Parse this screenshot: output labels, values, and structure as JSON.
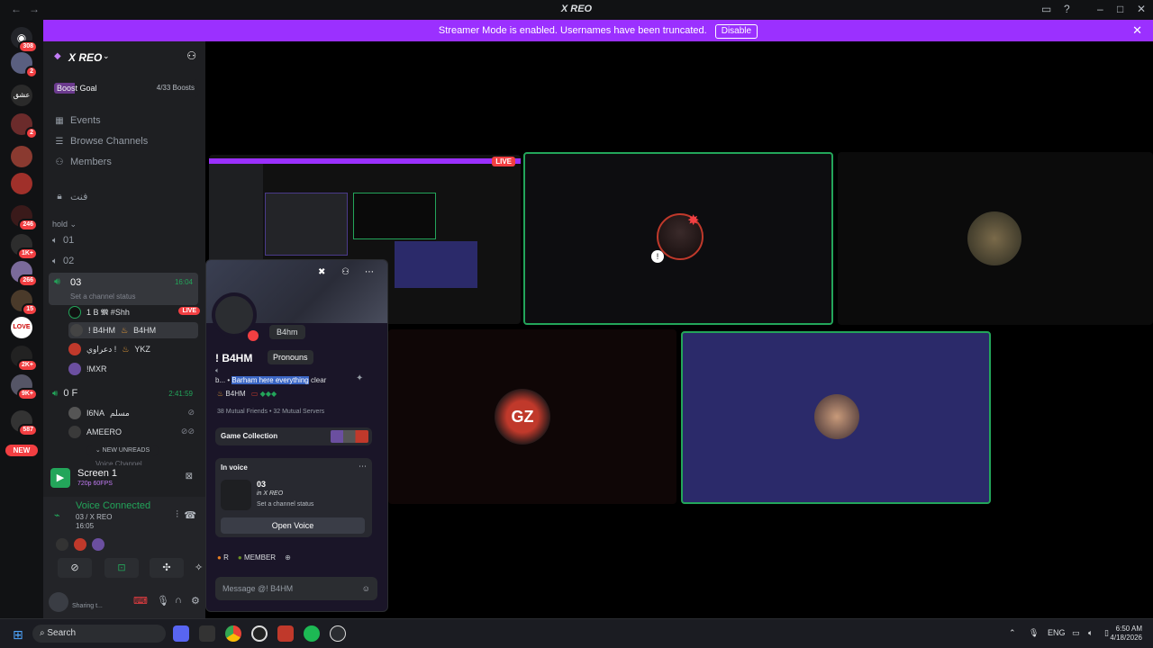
{
  "window": {
    "title": "X REO",
    "back_icon": "arrow-left-icon",
    "forward_icon": "arrow-right-icon",
    "controls": [
      "inbox-icon",
      "help-icon",
      "minimize-icon",
      "maximize-icon",
      "close-icon"
    ]
  },
  "banner": {
    "text": "Streamer Mode is enabled. Usernames have been truncated.",
    "disable_label": "Disable",
    "close_glyph": "✕"
  },
  "server_rail": {
    "badges": [
      "308",
      "2",
      "2",
      "246",
      "1K+",
      "266",
      "15",
      "2K+",
      "9K+",
      "587"
    ],
    "new_label": "NEW"
  },
  "server": {
    "name": "X REO",
    "boost_goal_label": "Boost Goal",
    "boost_count": "4/33 Boosts",
    "nav": [
      {
        "label": "Events",
        "icon": "calendar-icon"
      },
      {
        "label": "Browse Channels",
        "icon": "browse-icon"
      },
      {
        "label": "Members",
        "icon": "members-icon"
      }
    ],
    "locked_channel": "فنت",
    "category": "hold",
    "voice_channels": [
      {
        "name": "01"
      },
      {
        "name": "02"
      },
      {
        "name": "03",
        "time": "16:04",
        "status": "Set a channel status"
      }
    ],
    "members_03": [
      {
        "name": "‏1 B 𝕸 #Shh",
        "live": "LIVE"
      },
      {
        "name": "! B4HM",
        "tag": "B4HM"
      },
      {
        "name": "دعراوي !",
        "tag": "YKZ"
      },
      {
        "name": "!MXR"
      }
    ],
    "channel_0F": {
      "name": "0 F",
      "time": "2:41:59"
    },
    "members_0F": [
      {
        "name": "I6NA",
        "tag": "مسلم"
      },
      {
        "name": "AMEERO"
      }
    ],
    "new_unreads": "NEW UNREADS",
    "cutoff_channel": "Voice Channel"
  },
  "screen_share": {
    "title": "Screen 1",
    "quality": "720p 60FPS"
  },
  "voice": {
    "status": "Voice Connected",
    "channel": "03 / X REO",
    "time": "16:05"
  },
  "user": {
    "name": "‏‏‏",
    "status": "Sharing t..."
  },
  "profile": {
    "nickname": "B4hm",
    "display_name": "! B4HM",
    "pronouns_label": "Pronouns",
    "about_prefix": "b... •",
    "about_highlight": "Barham here everything",
    "about_suffix": "clear",
    "tag": "B4HM",
    "mutual_friends": "38 Mutual Friends",
    "mutual_servers": "32 Mutual Servers",
    "game_collection": "Game Collection",
    "in_voice": "In voice",
    "voice_channel": "03",
    "voice_server": "in X REO",
    "voice_status": "Set a channel status",
    "open_voice": "Open Voice",
    "roles": [
      "R",
      "MEMBER"
    ],
    "message_placeholder": "Message @! B4HM"
  },
  "stage": {
    "live_label": "LIVE"
  },
  "taskbar": {
    "search_label": "Search",
    "language": "ENG",
    "time": "6:50 AM",
    "date": "4/18/2026"
  },
  "colors": {
    "accent_purple": "#9b30ff",
    "speaking_green": "#23a55a",
    "live_red": "#f23f42",
    "stage_blue_tile": "#2b2a6a"
  }
}
